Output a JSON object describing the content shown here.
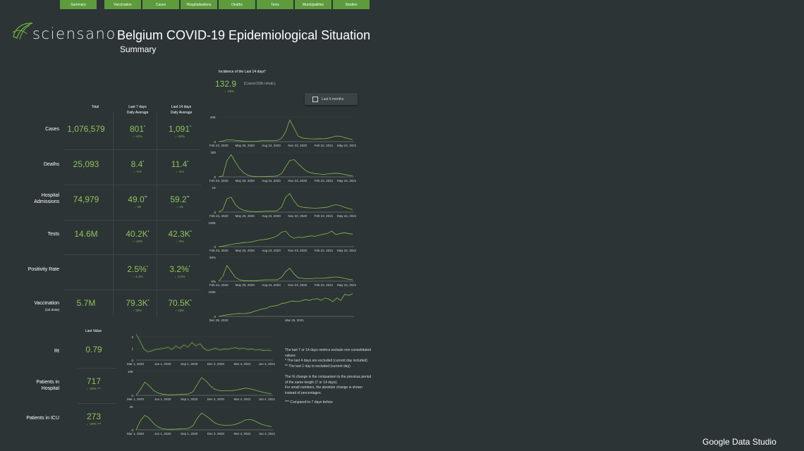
{
  "nav": {
    "tabs": [
      {
        "label": "Summary"
      },
      {
        "label": "Vaccination"
      },
      {
        "label": "Cases"
      },
      {
        "label": "Hospitalisations"
      },
      {
        "label": "Deaths"
      },
      {
        "label": "Tests"
      },
      {
        "label": "Municipalities"
      },
      {
        "label": "Studies"
      }
    ]
  },
  "logo": {
    "text": "sciensano"
  },
  "header": {
    "title": "Belgium COVID-19 Epidemiological Situation",
    "subtitle": "Summary"
  },
  "incidence": {
    "title": "Incidence of the Last 14 days*",
    "value": "132.9",
    "unit": "[Cases/100k Inhab.]",
    "change": "↓ -48%"
  },
  "filter": {
    "label": "Last 6 months",
    "checked": false
  },
  "table": {
    "headers": {
      "total": "Total",
      "last7": "Last 7 days\nDaily Average",
      "last14": "Last 14 days\nDaily Average"
    },
    "rows": [
      {
        "label": "Cases",
        "total": "1,076,579",
        "last7": "801",
        "last7_sup": "*",
        "last7_change": "↓ -42%",
        "last14": "1,091",
        "last14_sup": "*",
        "last14_change": "↓ -48%"
      },
      {
        "label": "Deaths",
        "total": "25,093",
        "last7": "8.4",
        "last7_sup": "*",
        "last7_change": "↓ -5.9",
        "last14": "11.4",
        "last14_sup": "*",
        "last14_change": "↓ -5.4"
      },
      {
        "label": "Hospital Admissions",
        "total": "74,979",
        "last7": "49.0",
        "last7_sup": "**",
        "last7_change": "↓ -20",
        "last14": "59.2",
        "last14_sup": "**",
        "last14_change": "↓ -41"
      },
      {
        "label": "Tests",
        "total": "14.6M",
        "last7": "40.2K",
        "last7_sup": "*",
        "last7_change": "↓ -10%",
        "last14": "42.3K",
        "last14_sup": "*",
        "last14_change": "↓ -9%"
      },
      {
        "label": "Positivity Rate",
        "total": "",
        "last7": "2.5%",
        "last7_sup": "*",
        "last7_change": "↓ -1.2%",
        "last14": "3.2%",
        "last14_sup": "*",
        "last14_change": "↓ -2.3%"
      },
      {
        "label": "Vaccination",
        "sublabel": "(1st dose)",
        "total": "5.7M",
        "last7": "79.3K",
        "last7_sup": "*",
        "last7_change": "↑ 29%",
        "last14": "70.5K",
        "last14_sup": "*",
        "last14_change": "↑ 43%"
      }
    ]
  },
  "lower": {
    "header": "Last Value",
    "rows": [
      {
        "label": "Rt",
        "value": "0.79",
        "change": ""
      },
      {
        "label": "Patients in Hospital",
        "value": "717",
        "change": "↓ -26% ***"
      },
      {
        "label": "Patients in ICU",
        "value": "273",
        "change": "↓ -19% ***"
      }
    ]
  },
  "notes": {
    "n1": "The last 7 or 14 days metrics exclude non consolidated values:",
    "n2": "*   The last 4 days are excluded (current day included)",
    "n3": "**  The last 1 day is excluded (current day)",
    "n4": "The % change is the comparison to the previous period of the same length (7 or 14 days).",
    "n5": "For small numbers, the absolute change is shown instead of percentages.",
    "n6": "*** Compared to 7 days before"
  },
  "footer": {
    "brand": "Google Data Studio"
  },
  "colors": {
    "accent": "#5e9b3c",
    "value": "#8fc35a",
    "line": "#86bd47",
    "bg": "#2c3436"
  },
  "chart_data": [
    {
      "type": "line",
      "name": "cases",
      "ylim": [
        0,
        20000
      ],
      "yticks": [
        "20K",
        "0"
      ],
      "xticks": [
        "Feb 24, 2020",
        "May 25, 2020",
        "Aug 24, 2020",
        "Nov 23, 2020",
        "Feb 22, 2021",
        "May 24, 2021"
      ],
      "values": [
        0,
        500,
        1500,
        1500,
        1100,
        700,
        400,
        250,
        200,
        250,
        600,
        900,
        900,
        800,
        1100,
        2500,
        8000,
        17500,
        11000,
        4500,
        3000,
        2500,
        2300,
        2200,
        2400,
        2300,
        2700,
        3500,
        4500,
        4400,
        3300,
        2500,
        1600
      ]
    },
    {
      "type": "line",
      "name": "deaths",
      "ylim": [
        0,
        300
      ],
      "yticks": [
        "300",
        "0"
      ],
      "xticks": [
        "Feb 24, 2020",
        "May 25, 2020",
        "Aug 24, 2020",
        "Nov 23, 2020",
        "Feb 22, 2021",
        "May 24, 2021"
      ],
      "values": [
        0,
        10,
        200,
        270,
        180,
        100,
        50,
        20,
        8,
        5,
        4,
        5,
        6,
        8,
        12,
        40,
        120,
        200,
        210,
        160,
        110,
        70,
        50,
        40,
        35,
        30,
        35,
        40,
        45,
        40,
        30,
        20,
        12
      ]
    },
    {
      "type": "line",
      "name": "hospital_admissions",
      "ylim": [
        0,
        1000
      ],
      "yticks": [
        "1K",
        "0"
      ],
      "xticks": [
        "Feb 24, 2020",
        "May 25, 2020",
        "Aug 24, 2020",
        "Nov 23, 2020",
        "Feb 22, 2021",
        "May 24, 2021"
      ],
      "values": [
        0,
        100,
        550,
        600,
        300,
        150,
        80,
        40,
        25,
        20,
        25,
        30,
        40,
        40,
        60,
        200,
        600,
        750,
        450,
        250,
        200,
        180,
        170,
        160,
        170,
        180,
        200,
        260,
        300,
        270,
        200,
        150,
        100
      ]
    },
    {
      "type": "line",
      "name": "tests",
      "ylim": [
        0,
        100000
      ],
      "yticks": [
        "100K",
        "0"
      ],
      "xticks": [
        "Feb 24, 2020",
        "May 25, 2020",
        "Aug 24, 2020",
        "Nov 23, 2020",
        "Feb 22, 2021",
        "May 24, 2021"
      ],
      "values": [
        0,
        2000,
        6000,
        9000,
        12000,
        14000,
        17000,
        18000,
        20000,
        25000,
        28000,
        30000,
        33000,
        38000,
        45000,
        60000,
        65000,
        45000,
        35000,
        40000,
        38000,
        42000,
        45000,
        43000,
        48000,
        52000,
        55000,
        65000,
        50000,
        55000,
        58000,
        55000,
        52000
      ]
    },
    {
      "type": "line",
      "name": "positivity_rate",
      "ylim": [
        0,
        50
      ],
      "yticks": [
        "50%",
        "0%"
      ],
      "xticks": [
        "Feb 24, 2020",
        "May 25, 2020",
        "Aug 24, 2020",
        "Nov 23, 2020",
        "Feb 22, 2021",
        "May 24, 2021"
      ],
      "values": [
        0,
        10,
        33,
        20,
        8,
        3,
        1,
        1,
        1,
        1,
        2,
        3,
        3,
        3,
        3,
        8,
        20,
        27,
        15,
        7,
        6,
        5,
        5,
        6,
        6,
        6,
        7,
        8,
        9,
        8,
        6,
        4,
        3
      ]
    },
    {
      "type": "line",
      "name": "vaccination",
      "ylim": [
        0,
        100000
      ],
      "yticks": [
        "100K",
        "0"
      ],
      "xticks": [
        "Dec 28, 2020",
        "Mar 29, 2021"
      ],
      "values": [
        0,
        3000,
        6000,
        8000,
        10000,
        12000,
        11000,
        12000,
        15000,
        20000,
        25000,
        30000,
        32000,
        40000,
        42000,
        45000,
        52000,
        55000,
        60000,
        62000,
        60000,
        63000,
        68000,
        65000,
        70000,
        72000,
        65000,
        75000,
        70000,
        60000,
        75000,
        65000,
        90000,
        85000,
        92000
      ]
    },
    {
      "type": "line",
      "name": "rt",
      "ylim": [
        0,
        2
      ],
      "yticks": [
        "2",
        "1",
        "0"
      ],
      "xticks": [
        "Mar 1, 2020",
        "Jun 1, 2020",
        "Sep 1, 2020",
        "Dec 2, 2020",
        "Mar 4, 2021",
        "Jun 4, 2021"
      ],
      "values": [
        2.3,
        1.6,
        0.9,
        0.7,
        0.8,
        0.9,
        0.95,
        1.0,
        1.1,
        0.9,
        1.2,
        1.0,
        1.3,
        1.1,
        1.5,
        1.2,
        1.4,
        1.0,
        0.8,
        0.9,
        1.0,
        0.85,
        0.95,
        0.9,
        1.0,
        1.05,
        0.95,
        1.0,
        0.9,
        0.95,
        0.85,
        0.9,
        0.8,
        0.85,
        0.79
      ]
    },
    {
      "type": "line",
      "name": "patients_in_hospital",
      "ylim": [
        0,
        10000
      ],
      "yticks": [
        "10K",
        "0"
      ],
      "xticks": [
        "Mar 1, 2020",
        "Jun 1, 2020",
        "Sep 1, 2020",
        "Dec 2, 2020",
        "Mar 4, 2021",
        "Jun 4, 2021"
      ],
      "values": [
        0,
        2500,
        5500,
        4000,
        2000,
        1000,
        500,
        300,
        250,
        300,
        400,
        500,
        600,
        1500,
        4500,
        7400,
        6000,
        4000,
        2500,
        2000,
        1900,
        1900,
        2000,
        2200,
        2600,
        3000,
        2800,
        2300,
        1800,
        1300,
        900,
        717
      ]
    },
    {
      "type": "line",
      "name": "patients_in_icu",
      "ylim": [
        0,
        2000
      ],
      "yticks": [
        "2K",
        "0"
      ],
      "xticks": [
        "Mar 1, 2020",
        "Jun 1, 2020",
        "Sep 1, 2020",
        "Dec 2, 2020",
        "Mar 4, 2021",
        "Jun 4, 2021"
      ],
      "values": [
        0,
        800,
        1250,
        1000,
        550,
        250,
        100,
        60,
        50,
        60,
        80,
        100,
        130,
        350,
        1000,
        1450,
        1200,
        900,
        600,
        450,
        400,
        400,
        420,
        500,
        650,
        850,
        900,
        800,
        600,
        450,
        350,
        273
      ]
    }
  ]
}
